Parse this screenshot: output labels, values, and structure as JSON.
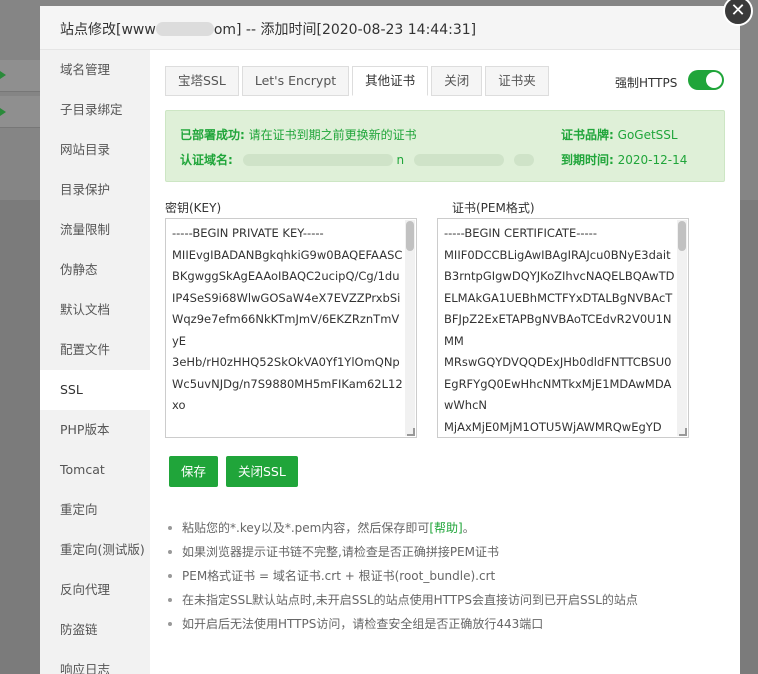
{
  "dialog": {
    "title_prefix": "站点修改[www",
    "title_suffix": "om] -- 添加时间[2020-08-23 14:44:31]"
  },
  "sidebar": {
    "items": [
      {
        "label": "域名管理"
      },
      {
        "label": "子目录绑定"
      },
      {
        "label": "网站目录"
      },
      {
        "label": "目录保护"
      },
      {
        "label": "流量限制"
      },
      {
        "label": "伪静态"
      },
      {
        "label": "默认文档"
      },
      {
        "label": "配置文件"
      },
      {
        "label": "SSL"
      },
      {
        "label": "PHP版本"
      },
      {
        "label": "Tomcat"
      },
      {
        "label": "重定向"
      },
      {
        "label": "重定向(测试版)"
      },
      {
        "label": "反向代理"
      },
      {
        "label": "防盗链"
      },
      {
        "label": "响应日志"
      }
    ],
    "active_label": "SSL"
  },
  "tabs": [
    {
      "label": "宝塔SSL"
    },
    {
      "label": "Let's Encrypt"
    },
    {
      "label": "其他证书"
    },
    {
      "label": "关闭"
    },
    {
      "label": "证书夹"
    }
  ],
  "active_tab": "其他证书",
  "force_https": {
    "label": "强制HTTPS",
    "enabled": true
  },
  "status": {
    "deployed_label": "已部署成功:",
    "deployed_msg": "请在证书到期之前更换新的证书",
    "domain_label": "认证域名:",
    "domain_visible_char": "n",
    "brand_label": "证书品牌:",
    "brand_value": "GoGetSSL",
    "expire_label": "到期时间:",
    "expire_value": "2020-12-14"
  },
  "key": {
    "label": "密钥(KEY)",
    "value": "-----BEGIN PRIVATE KEY-----\nMIIEvgIBADANBgkqhkiG9w0BAQEFAASCBKgwggSkAgEAAoIBAQC2ucipQ/Cg/1du\nIP4SeS9i68WlwGOSaW4eX7EVZZPrxbSiWqz9e7efm66NkKTmJmV/6EKZRznTmVyE\n3eHb/rH0zHHQ52SkOkVA0Yf1YlOmQNpWc5uvNJDg/n7S9880MH5mFIKam62L12xo"
  },
  "cert": {
    "label": "证书(PEM格式)",
    "value": "-----BEGIN CERTIFICATE-----\nMIIF0DCCBLigAwIBAgIRAJcu0BNyE3daitB3rntpGIgwDQYJKoZIhvcNAQELBQAwTDELMAkGA1UEBhMCTFYxDTALBgNVBAcTBFJpZ2ExETAPBgNVBAoTCEdvR2V0U1NMM\nMRswGQYDVQQDExJHb0dldFNTTCBSU0EgRFYgQ0EwHhcNMTkxMjE1MDAwMDAwWhcN\nMjAxMjE0MjM1OTU5WjAWMRQwEgYD"
  },
  "buttons": {
    "save": "保存",
    "close_ssl": "关闭SSL"
  },
  "tips": {
    "tip1_prefix": "粘贴您的*.key以及*.pem内容，然后保存即可",
    "tip1_link": "[帮助]",
    "tip1_suffix": "。",
    "tip2": "如果浏览器提示证书链不完整,请检查是否正确拼接PEM证书",
    "tip3": "PEM格式证书 = 域名证书.crt + 根证书(root_bundle).crt",
    "tip4": "在未指定SSL默认站点时,未开启SSL的站点使用HTTPS会直接访问到已开启SSL的站点",
    "tip5": "如开启后无法使用HTTPS访问，请检查安全组是否正确放行443端口"
  },
  "colors": {
    "accent": "#20a53a",
    "success_bg": "#dff0d8"
  },
  "icons": {
    "close": "close-icon",
    "toggle": "toggle-switch"
  }
}
